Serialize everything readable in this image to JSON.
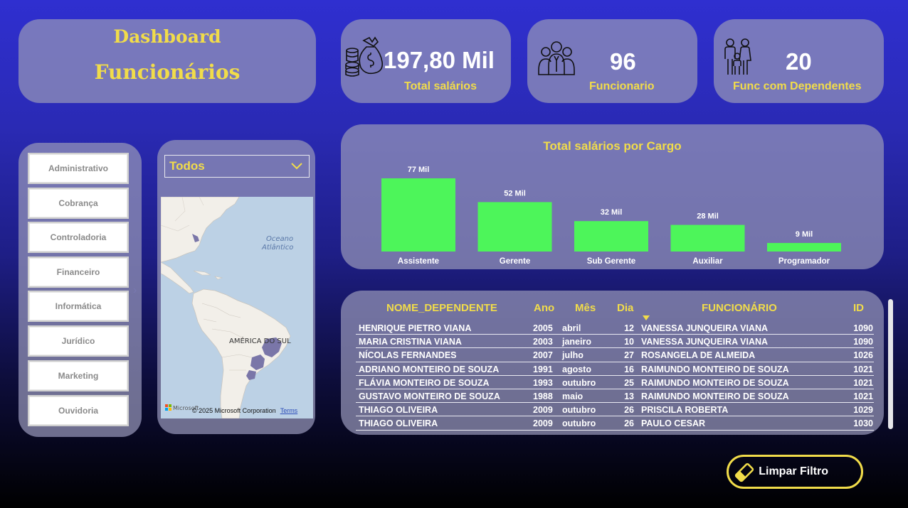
{
  "title": {
    "line1": "Dashboard",
    "line2": "Funcionários"
  },
  "kpis": {
    "salarios": {
      "value": "197,80 Mil",
      "label": "Total salários",
      "icon": "money-bag-coins-icon"
    },
    "funcionarios": {
      "value": "96",
      "label": "Funcionario",
      "icon": "team-people-icon"
    },
    "dependentes": {
      "value": "20",
      "label": "Func com Dependentes",
      "icon": "family-icon"
    }
  },
  "departments": [
    "Administrativo",
    "Cobrança",
    "Controladoria",
    "Financeiro",
    "Informática",
    "Jurídico",
    "Marketing",
    "Ouvidoria"
  ],
  "region_filter": {
    "selected": "Todos"
  },
  "map": {
    "ocean_label_1": "Oceano",
    "ocean_label_2": "Atlântico",
    "continent_label": "AMÉRICA DO SUL",
    "brand": "Microsoft",
    "copyright": "© 2025 Microsoft Corporation",
    "terms": "Terms"
  },
  "chart_data": {
    "type": "bar",
    "title": "Total salários por Cargo",
    "categories": [
      "Assistente",
      "Gerente",
      "Sub Gerente",
      "Auxiliar",
      "Programador"
    ],
    "values": [
      77,
      52,
      32,
      28,
      9
    ],
    "data_labels": [
      "77 Mil",
      "52 Mil",
      "32 Mil",
      "28 Mil",
      "9 Mil"
    ],
    "xlabel": "",
    "ylabel": "",
    "ylim": [
      0,
      77
    ],
    "grid": false,
    "bar_color": "#4df55a"
  },
  "table": {
    "headers": {
      "nome": "NOME_DEPENDENTE",
      "ano": "Ano",
      "mes": "Mês",
      "dia": "Dia",
      "funcionario": "FUNCIONÁRIO",
      "id": "ID"
    },
    "rows": [
      {
        "nome": "HENRIQUE PIETRO VIANA",
        "ano": "2005",
        "mes": "abril",
        "dia": "12",
        "funcionario": "VANESSA JUNQUEIRA VIANA",
        "id": "1090"
      },
      {
        "nome": "MARIA CRISTINA VIANA",
        "ano": "2003",
        "mes": "janeiro",
        "dia": "10",
        "funcionario": "VANESSA JUNQUEIRA VIANA",
        "id": "1090"
      },
      {
        "nome": "NÍCOLAS FERNANDES",
        "ano": "2007",
        "mes": "julho",
        "dia": "27",
        "funcionario": "ROSANGELA DE ALMEIDA",
        "id": "1026"
      },
      {
        "nome": "ADRIANO MONTEIRO DE SOUZA",
        "ano": "1991",
        "mes": "agosto",
        "dia": "16",
        "funcionario": "RAIMUNDO MONTEIRO DE SOUZA",
        "id": "1021"
      },
      {
        "nome": "FLÁVIA MONTEIRO DE SOUZA",
        "ano": "1993",
        "mes": "outubro",
        "dia": "25",
        "funcionario": "RAIMUNDO MONTEIRO DE SOUZA",
        "id": "1021"
      },
      {
        "nome": "GUSTAVO MONTEIRO DE SOUZA",
        "ano": "1988",
        "mes": "maio",
        "dia": "13",
        "funcionario": "RAIMUNDO MONTEIRO DE SOUZA",
        "id": "1021"
      },
      {
        "nome": "THIAGO OLIVEIRA",
        "ano": "2009",
        "mes": "outubro",
        "dia": "26",
        "funcionario": "PRISCILA ROBERTA",
        "id": "1029"
      },
      {
        "nome": "THIAGO OLIVEIRA",
        "ano": "2009",
        "mes": "outubro",
        "dia": "26",
        "funcionario": "PAULO CESAR",
        "id": "1030"
      }
    ]
  },
  "clear_filter": {
    "label": "Limpar Filtro",
    "icon": "eraser-icon"
  },
  "colors": {
    "accent": "#f1dc4a",
    "bar": "#4df55a",
    "card": "#9696b9"
  }
}
